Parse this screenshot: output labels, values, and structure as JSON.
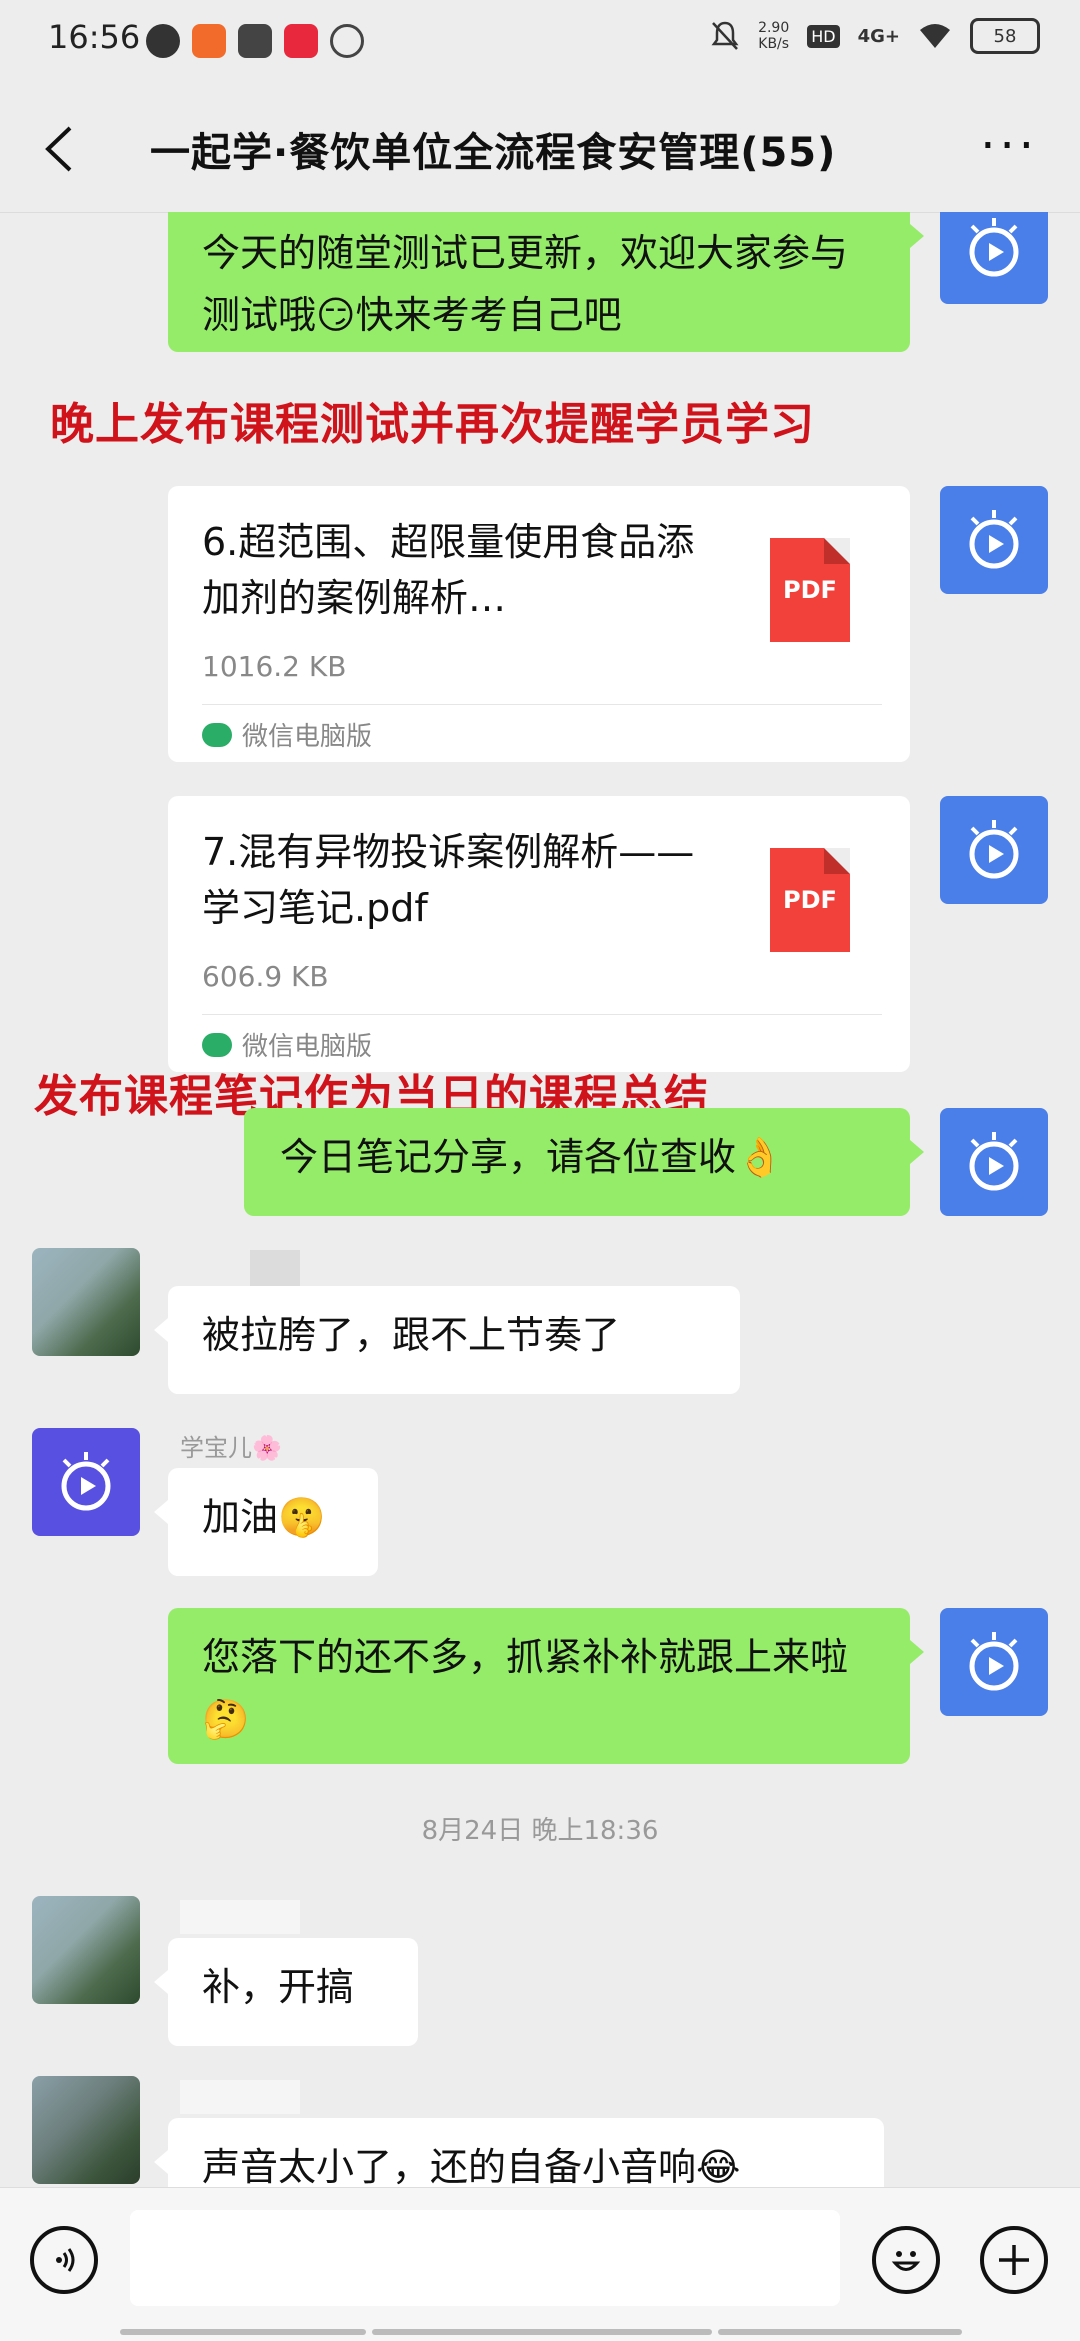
{
  "status_bar": {
    "time": "16:56",
    "net_speed_value": "2.90",
    "net_speed_unit": "KB/s",
    "hd": "HD",
    "network": "4G+",
    "battery": "58"
  },
  "nav": {
    "title": "一起学·餐饮单位全流程食安管理(55)"
  },
  "messages": {
    "m1_text": "今天的随堂测试已更新，欢迎大家参与测试哦😏快来考考自己吧",
    "annotation1": "晚上发布课程测试并再次提醒学员学习",
    "file1_name": "6.超范围、超限量使用食品添加剂的案例解析…",
    "file1_size": "1016.2 KB",
    "file1_source": "微信电脑版",
    "file2_name": "7.混有异物投诉案例解析——学习笔记.pdf",
    "file2_size": "606.9 KB",
    "file2_source": "微信电脑版",
    "pdf_label": "PDF",
    "annotation2": "发布课程笔记作为当日的课程总结",
    "m2_text": "今日笔记分享，请各位查收👌",
    "m3_text": "被拉胯了，跟不上节奏了",
    "nick_xuebao": "学宝儿🌸",
    "m4_text": "加油🤫",
    "m5_text": "您落下的还不多，抓紧补补就跟上来啦🤔",
    "timestamp": "8月24日 晚上18:36",
    "m6_text": "补，开搞",
    "m7_text": "声音太小了，还的自备小音响😂"
  },
  "colors": {
    "green_bubble": "#95ec69",
    "annotation_red": "#d0121b",
    "app_avatar_blue": "#4a7ee8",
    "pdf_red": "#f2413b"
  },
  "icons": {
    "back": "chevron-left-icon",
    "more": "more-dots-icon",
    "voice": "voice-icon",
    "emoji": "emoji-icon",
    "plus": "plus-icon"
  }
}
